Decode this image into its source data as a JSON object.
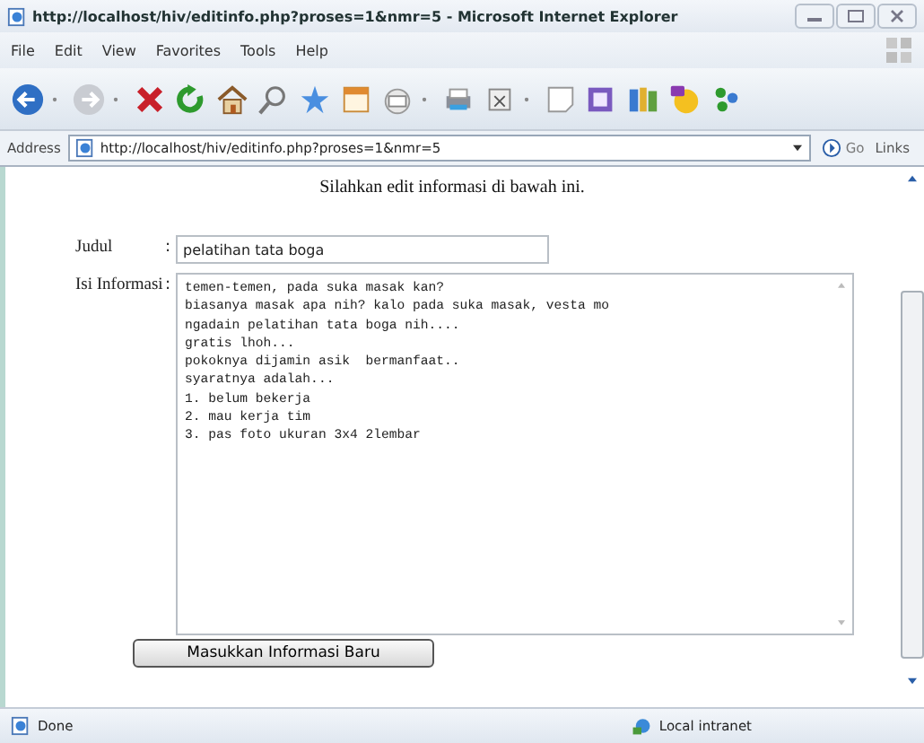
{
  "window": {
    "title": "http://localhost/hiv/editinfo.php?proses=1&nmr=5 - Microsoft Internet Explorer"
  },
  "menu": [
    "File",
    "Edit",
    "View",
    "Favorites",
    "Tools",
    "Help"
  ],
  "address_bar": {
    "label": "Address",
    "value": "http://localhost/hiv/editinfo.php?proses=1&nmr=5",
    "go": "Go",
    "links": "Links"
  },
  "page": {
    "heading": "Silahkan edit informasi di bawah ini.",
    "fields": [
      {
        "kind": "input",
        "label": "Judul",
        "separator": ":",
        "value": "pelatihan tata boga"
      },
      {
        "kind": "textarea",
        "label": "Isi Informasi",
        "separator": ":",
        "value": "temen-temen, pada suka masak kan?\nbiasanya masak apa nih? kalo pada suka masak, vesta mo\nngadain pelatihan tata boga nih....\ngratis lhoh...\npokoknya dijamin asik  bermanfaat..\nsyaratnya adalah...\n1. belum bekerja\n2. mau kerja tim\n3. pas foto ukuran 3x4 2lembar"
      }
    ],
    "button": "Masukkan Informasi Baru"
  },
  "status_bar": {
    "status": "Done",
    "zone": "Local intranet"
  }
}
